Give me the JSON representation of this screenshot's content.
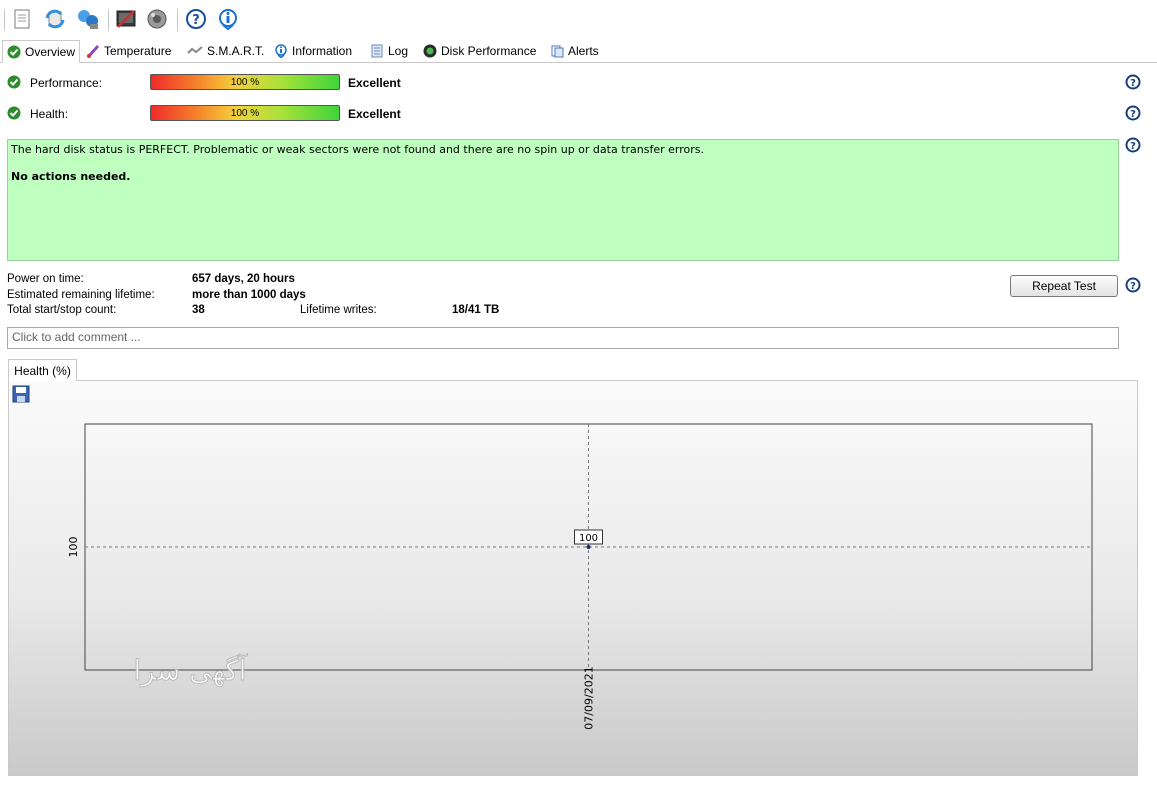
{
  "toolbar": {
    "buttons": [
      "document-icon",
      "refresh-icon",
      "network-icon",
      "disk-check-icon",
      "sound-icon",
      "help-icon",
      "info-icon"
    ]
  },
  "tabs": [
    {
      "label": "Overview",
      "icon": "check-circle-icon",
      "active": true
    },
    {
      "label": "Temperature",
      "icon": "thermometer-icon"
    },
    {
      "label": "S.M.A.R.T.",
      "icon": "smart-icon"
    },
    {
      "label": "Information",
      "icon": "info-icon"
    },
    {
      "label": "Log",
      "icon": "log-icon"
    },
    {
      "label": "Disk Performance",
      "icon": "gauge-icon"
    },
    {
      "label": "Alerts",
      "icon": "alerts-icon"
    }
  ],
  "performance": {
    "label": "Performance:",
    "bar_text": "100 %",
    "value_percent": 100,
    "rating": "Excellent"
  },
  "health": {
    "label": "Health:",
    "bar_text": "100 %",
    "value_percent": 100,
    "rating": "Excellent"
  },
  "status": {
    "message": "The hard disk status is PERFECT. Problematic or weak sectors were not found and there are no spin up or data transfer errors.",
    "action": "No actions needed.",
    "color": "#bfffbf"
  },
  "info": {
    "power_on_label": "Power on time:",
    "power_on_value": "657 days, 20 hours",
    "lifetime_label": "Estimated remaining lifetime:",
    "lifetime_value": "more than 1000 days",
    "startstop_label": "Total start/stop count:",
    "startstop_value": "38",
    "writes_label": "Lifetime writes:",
    "writes_value": "18/41 TB"
  },
  "repeat_button": "Repeat Test",
  "comment_placeholder": "Click to add comment ...",
  "chart_tab": "Health (%)",
  "watermark": "آگهی سرا",
  "chart_data": {
    "type": "line",
    "title": "",
    "xlabel": "",
    "ylabel": "",
    "x": [
      "07/09/2021"
    ],
    "series": [
      {
        "values": [
          100
        ]
      }
    ],
    "point_labels": [
      "100"
    ],
    "y_ticks": [
      "100"
    ],
    "ylim": [
      99,
      101
    ],
    "grid": true
  }
}
